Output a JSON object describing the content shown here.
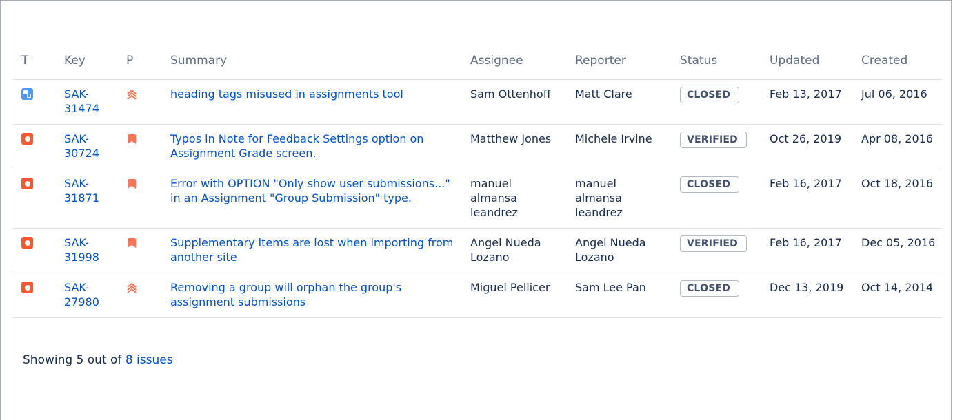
{
  "columns": {
    "t": "T",
    "key": "Key",
    "p": "P",
    "summary": "Summary",
    "assignee": "Assignee",
    "reporter": "Reporter",
    "status": "Status",
    "updated": "Updated",
    "created": "Created"
  },
  "colors": {
    "link": "#0052cc",
    "subtask": "#4c9aff",
    "bug": "#ff5630",
    "priority": "#ff7452"
  },
  "issues": [
    {
      "type": "subtask-icon",
      "key": "SAK-31474",
      "priority": "major-icon",
      "summary": "heading tags misused in assignments tool",
      "assignee": "Sam Ottenhoff",
      "reporter": "Matt Clare",
      "status": "CLOSED",
      "updated": "Feb 13, 2017",
      "created": "Jul 06, 2016"
    },
    {
      "type": "bug-icon",
      "key": "SAK-30724",
      "priority": "minor-icon",
      "summary": "Typos in Note for Feedback Settings option on Assignment Grade screen.",
      "assignee": "Matthew Jones",
      "reporter": "Michele Irvine",
      "status": "VERIFIED",
      "updated": "Oct 26, 2019",
      "created": "Apr 08, 2016"
    },
    {
      "type": "bug-icon",
      "key": "SAK-31871",
      "priority": "minor-icon",
      "summary": "Error with OPTION \"Only show user submissions...\" in an Assignment \"Group Submission\" type.",
      "assignee": "manuel almansa leandrez",
      "reporter": "manuel almansa leandrez",
      "status": "CLOSED",
      "updated": "Feb 16, 2017",
      "created": "Oct 18, 2016"
    },
    {
      "type": "bug-icon",
      "key": "SAK-31998",
      "priority": "minor-icon",
      "summary": "Supplementary items are lost when importing from another site",
      "assignee": "Angel Nueda Lozano",
      "reporter": "Angel Nueda Lozano",
      "status": "VERIFIED",
      "updated": "Feb 16, 2017",
      "created": "Dec 05, 2016"
    },
    {
      "type": "bug-icon",
      "key": "SAK-27980",
      "priority": "major-icon",
      "summary": "Removing a group will orphan the group's assignment submissions",
      "assignee": "Miguel Pellicer",
      "reporter": "Sam Lee Pan",
      "status": "CLOSED",
      "updated": "Dec 13, 2019",
      "created": "Oct 14, 2014"
    }
  ],
  "footer": {
    "prefix": "Showing 5 out of ",
    "link": "8 issues"
  }
}
